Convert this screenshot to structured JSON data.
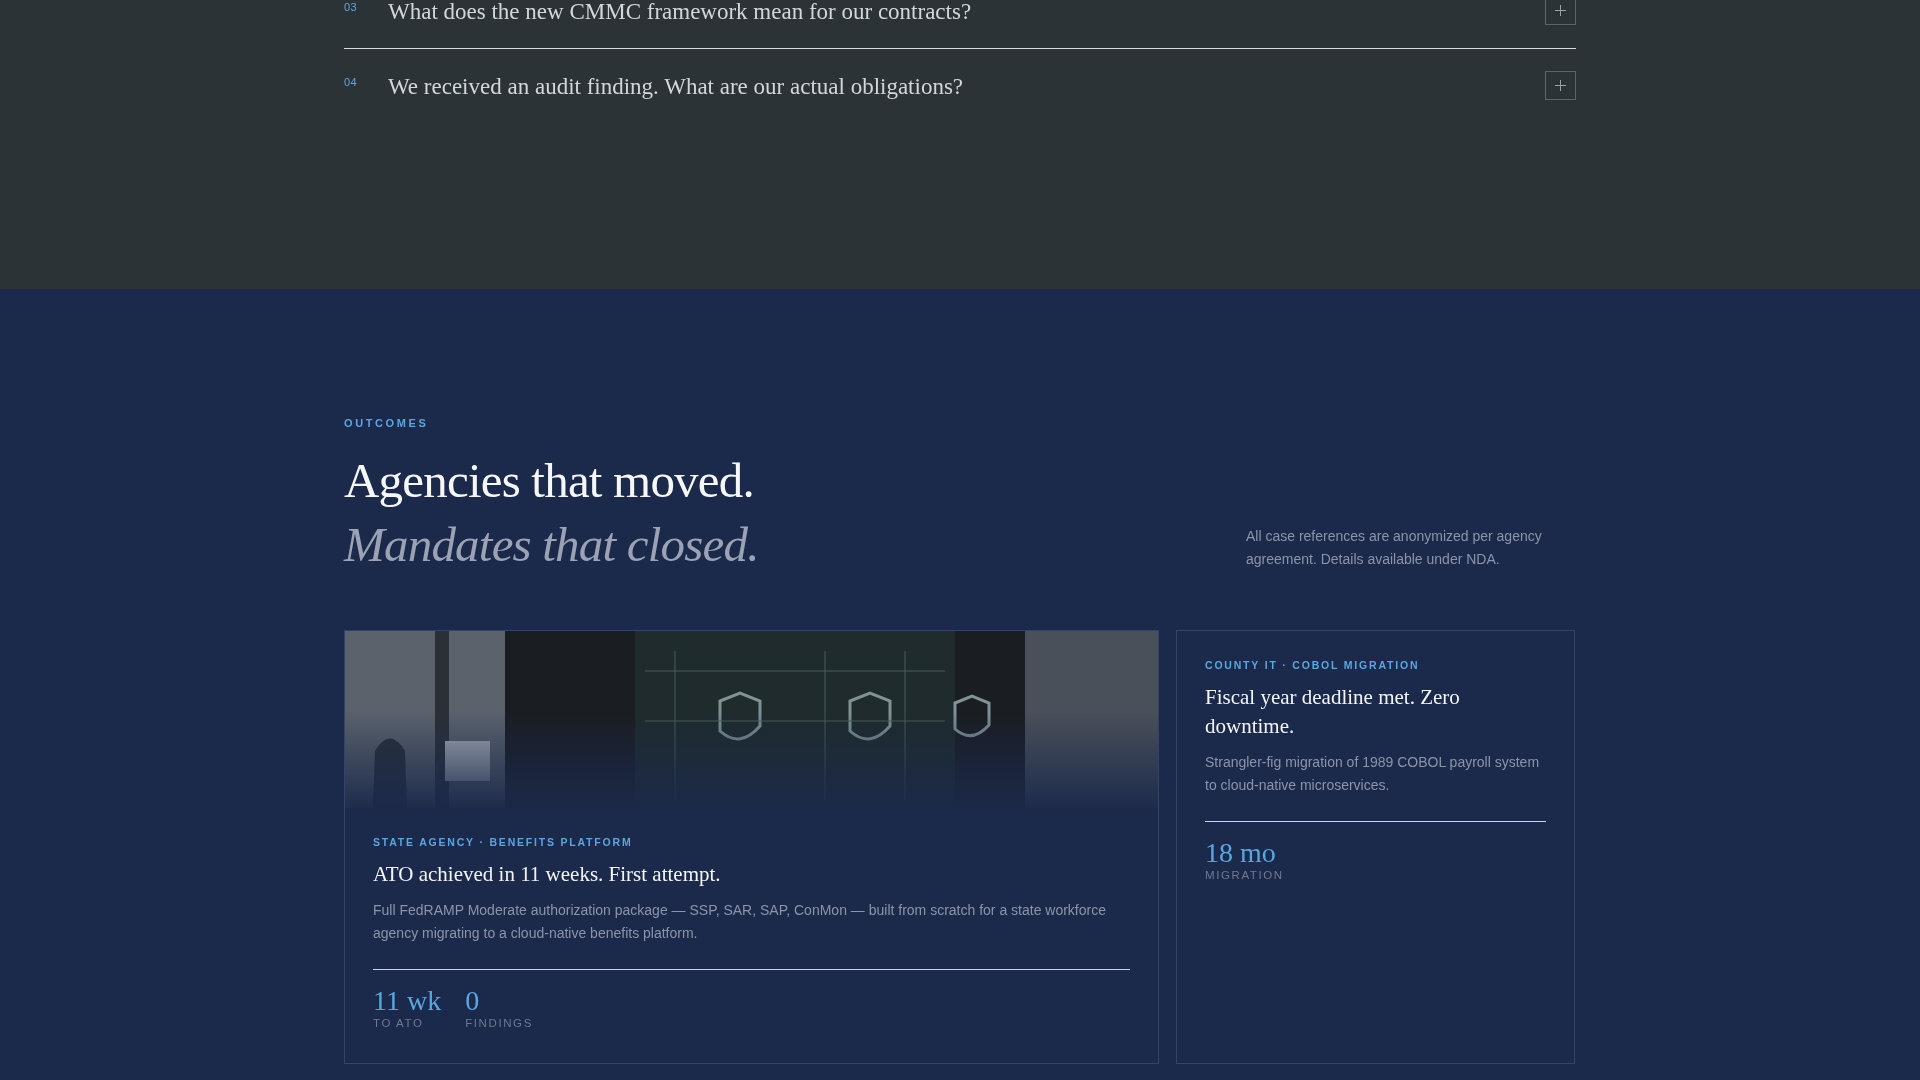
{
  "faq": {
    "items": [
      {
        "number": "03",
        "question": "What does the new CMMC framework mean for our contracts?",
        "expanded": false
      },
      {
        "number": "04",
        "question": "We received an audit finding. What are our actual obligations?",
        "expanded": false
      }
    ]
  },
  "outcomes": {
    "eyebrow": "OUTCOMES",
    "headline": "Agencies that moved.",
    "headline_italic": "Mandates that closed.",
    "note": "All case references are anonymized per agency agreement. Details available under NDA.",
    "cases": [
      {
        "kind": "picture",
        "tag": "STATE AGENCY · BENEFITS PLATFORM",
        "title": "ATO achieved in 11 weeks. First attempt.",
        "description": "Full FedRAMP Moderate authorization package — SSP, SAR, SAP, ConMon — built from scratch for a state workforce agency migrating to a cloud-native benefits platform.",
        "stats": [
          {
            "value": "11 wk",
            "label": "TO ATO"
          },
          {
            "value": "0",
            "label": "FINDINGS"
          }
        ]
      },
      {
        "kind": "text",
        "tag": "COUNTY IT · COBOL MIGRATION",
        "title": "Fiscal year deadline met. Zero downtime.",
        "description": "Strangler-fig migration of 1989 COBOL payroll system to cloud-native microservices.",
        "stats": [
          {
            "value": "18 mo",
            "label": "MIGRATION"
          }
        ]
      }
    ]
  }
}
